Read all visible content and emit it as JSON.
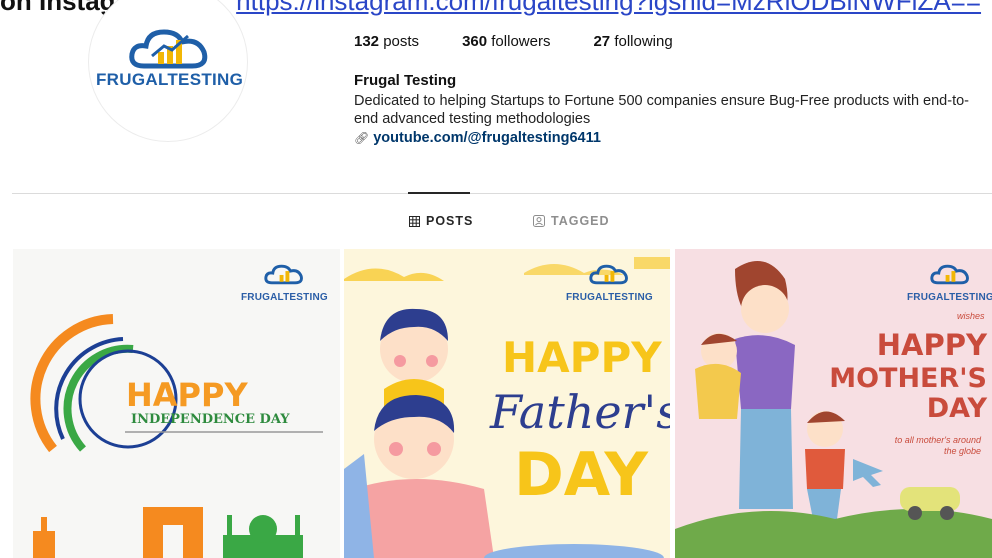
{
  "header": {
    "prefix": "on Instagram – ",
    "url": "https://instagram.com/frugaltesting?igshid=MzRlODBiNWFlZA=="
  },
  "profile": {
    "logo_text_a": "FRUGAL",
    "logo_text_b": "TESTING",
    "stats": {
      "posts_num": "132",
      "posts_label": "posts",
      "followers_num": "360",
      "followers_label": "followers",
      "following_num": "27",
      "following_label": "following"
    },
    "name": "Frugal Testing",
    "bio": "Dedicated to helping Startups to Fortune 500 companies ensure Bug-Free products with end-to-end advanced testing methodologies",
    "link": "youtube.com/@frugaltesting6411"
  },
  "tabs": {
    "posts": "POSTS",
    "tagged": "TAGGED"
  },
  "posts": [
    {
      "brand": "FRUGALTESTING",
      "line1": "HAPPY",
      "line2": "INDEPENDENCE DAY"
    },
    {
      "brand": "FRUGALTESTING",
      "line1": "HAPPY",
      "line2": "Father's",
      "line3": "DAY"
    },
    {
      "brand": "FRUGALTESTING",
      "wishes": "wishes",
      "line1": "HAPPY",
      "line2": "MOTHER'S",
      "line3": "DAY",
      "sub1": "to all mother's around",
      "sub2": "the globe"
    }
  ],
  "colors": {
    "brand_blue": "#2b5ea7",
    "logo_gold": "#f2b705",
    "accent_orange": "#f59a23",
    "father_yellow": "#f7c51a",
    "mother_red": "#c94b3c"
  }
}
